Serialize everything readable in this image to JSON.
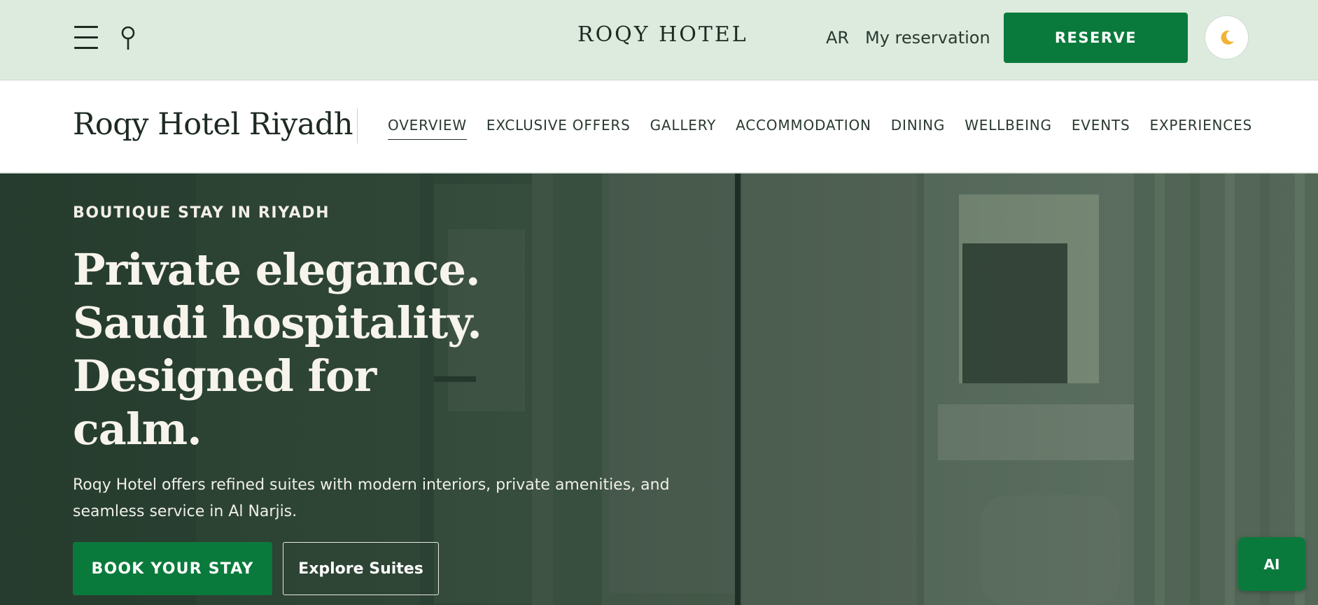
{
  "header": {
    "menu_icon": "hamburger-menu-icon",
    "search_icon": "search-icon",
    "brand": "ROQY HOTEL",
    "lang_toggle": "AR",
    "my_reservation": "My reservation",
    "reserve_label": "RESERVE",
    "theme_icon": "moon-icon"
  },
  "subnav": {
    "hotel_name": "Roqy Hotel Riyadh",
    "tabs": [
      {
        "label": "OVERVIEW",
        "active": true
      },
      {
        "label": "EXCLUSIVE OFFERS",
        "active": false
      },
      {
        "label": "GALLERY",
        "active": false
      },
      {
        "label": "ACCOMMODATION",
        "active": false
      },
      {
        "label": "DINING",
        "active": false
      },
      {
        "label": "WELLBEING",
        "active": false
      },
      {
        "label": "EVENTS",
        "active": false
      },
      {
        "label": "EXPERIENCES",
        "active": false
      }
    ]
  },
  "hero": {
    "eyebrow": "BOUTIQUE STAY IN RIYADH",
    "headline_lines": [
      "Private elegance.",
      "Saudi hospitality.",
      "Designed for",
      "calm."
    ],
    "description": "Roqy Hotel offers refined suites with modern interiors, private amenities, and seamless service in Al Narjis.",
    "primary_cta": "BOOK YOUR STAY",
    "secondary_cta": "Explore Suites"
  },
  "ai_button": "AI",
  "colors": {
    "topbar_bg": "#dcebdd",
    "accent_green": "#0a7a3c",
    "text_dark": "#1d2a22",
    "hero_text": "#f7f4ec"
  }
}
